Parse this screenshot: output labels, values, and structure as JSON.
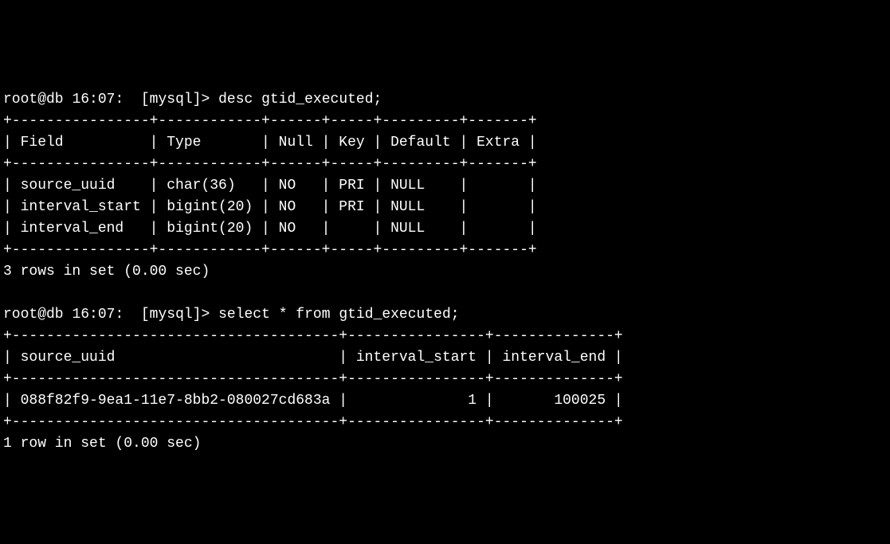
{
  "prompt1": {
    "user_host": "root@db",
    "time": "16:07",
    "context": "[mysql]>",
    "command": "desc gtid_executed;"
  },
  "table1": {
    "border_top": "+----------------+------------+------+-----+---------+-------+",
    "header_line": "| Field          | Type       | Null | Key | Default | Extra |",
    "border_mid": "+----------------+------------+------+-----+---------+-------+",
    "rows": [
      "| source_uuid    | char(36)   | NO   | PRI | NULL    |       |",
      "| interval_start | bigint(20) | NO   | PRI | NULL    |       |",
      "| interval_end   | bigint(20) | NO   |     | NULL    |       |"
    ],
    "border_bot": "+----------------+------------+------+-----+---------+-------+",
    "status": "3 rows in set (0.00 sec)"
  },
  "prompt2": {
    "user_host": "root@db",
    "time": "16:07",
    "context": "[mysql]>",
    "command": "select * from gtid_executed;"
  },
  "table2": {
    "border_top": "+--------------------------------------+----------------+--------------+",
    "header_line": "| source_uuid                          | interval_start | interval_end |",
    "border_mid": "+--------------------------------------+----------------+--------------+",
    "rows": [
      "| 088f82f9-9ea1-11e7-8bb2-080027cd683a |              1 |       100025 |"
    ],
    "border_bot": "+--------------------------------------+----------------+--------------+",
    "status": "1 row in set (0.00 sec)"
  },
  "chart_data": {
    "type": "table",
    "tables": [
      {
        "title": "desc gtid_executed",
        "columns": [
          "Field",
          "Type",
          "Null",
          "Key",
          "Default",
          "Extra"
        ],
        "rows": [
          [
            "source_uuid",
            "char(36)",
            "NO",
            "PRI",
            "NULL",
            ""
          ],
          [
            "interval_start",
            "bigint(20)",
            "NO",
            "PRI",
            "NULL",
            ""
          ],
          [
            "interval_end",
            "bigint(20)",
            "NO",
            "",
            "NULL",
            ""
          ]
        ]
      },
      {
        "title": "select * from gtid_executed",
        "columns": [
          "source_uuid",
          "interval_start",
          "interval_end"
        ],
        "rows": [
          [
            "088f82f9-9ea1-11e7-8bb2-080027cd683a",
            1,
            100025
          ]
        ]
      }
    ]
  }
}
